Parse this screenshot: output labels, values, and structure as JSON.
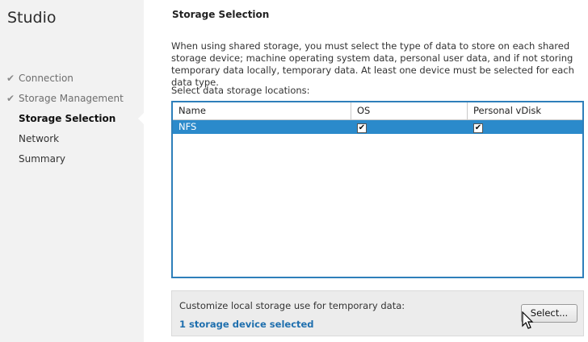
{
  "app": {
    "title": "Studio"
  },
  "steps": [
    {
      "label": "Connection",
      "state": "done"
    },
    {
      "label": "Storage Management",
      "state": "done"
    },
    {
      "label": "Storage Selection",
      "state": "current"
    },
    {
      "label": "Network",
      "state": "todo"
    },
    {
      "label": "Summary",
      "state": "todo"
    }
  ],
  "page": {
    "title": "Storage Selection",
    "description": "When using shared storage, you must select the type of data to store on each shared storage device; machine operating system data, personal user data, and if not storing temporary data locally, temporary data. At least one device must be selected for each data type.",
    "select_label": "Select data storage locations:"
  },
  "grid": {
    "columns": [
      "Name",
      "OS",
      "Personal vDisk"
    ],
    "rows": [
      {
        "name": "NFS",
        "os": true,
        "pvd": true,
        "selected": true
      }
    ]
  },
  "temp": {
    "label": "Customize local storage use for temporary data:",
    "link": "1 storage device selected",
    "button": "Select..."
  },
  "colors": {
    "accent": "#2b8acb",
    "link": "#1f6fae"
  }
}
